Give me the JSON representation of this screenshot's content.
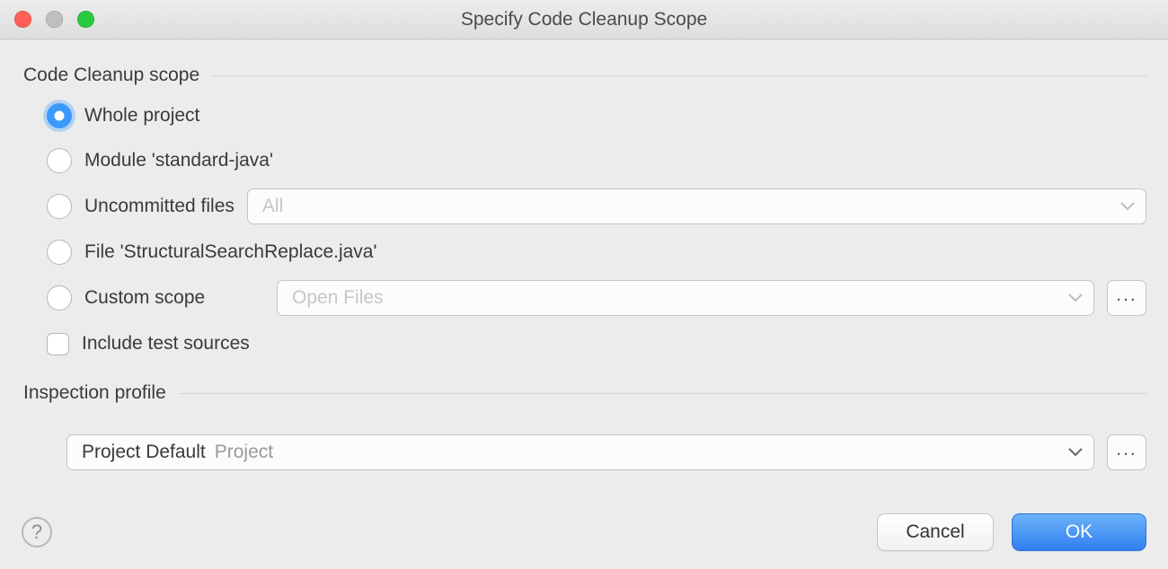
{
  "window": {
    "title": "Specify Code Cleanup Scope"
  },
  "scope": {
    "section_label": "Code Cleanup scope",
    "options": {
      "whole_project": "Whole project",
      "module": "Module 'standard-java'",
      "uncommitted": "Uncommitted files",
      "file": "File 'StructuralSearchReplace.java'",
      "custom": "Custom scope",
      "include_tests": "Include test sources"
    },
    "uncommitted_combo": {
      "value": "All"
    },
    "custom_combo": {
      "value": "Open Files"
    },
    "selected": "whole_project",
    "include_tests_checked": false
  },
  "inspection": {
    "section_label": "Inspection profile",
    "profile": {
      "name": "Project Default",
      "scope": "Project"
    }
  },
  "buttons": {
    "help": "?",
    "cancel": "Cancel",
    "ok": "OK",
    "more": "..."
  }
}
